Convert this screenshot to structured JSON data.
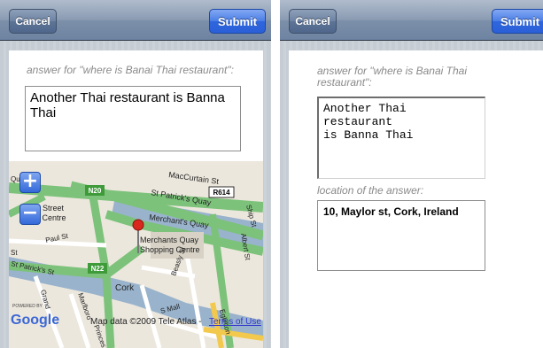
{
  "left": {
    "navbar": {
      "cancel_label": "Cancel",
      "submit_label": "Submit"
    },
    "question_label": "answer for \"where is Banai Thai restaurant\":",
    "answer_text": "Another Thai restaurant is Banna Thai",
    "map": {
      "zoom_in": "+",
      "zoom_out": "−",
      "streets": [
        "MacCurtain St",
        "St Patrick's Quay",
        "R614",
        "Ship St",
        "Merchant's Quay",
        "N20",
        "N22",
        "Paul St",
        "St Patrick's St",
        "Cork",
        "Princes St",
        "Beasly St",
        "S Mall",
        "Albert St",
        "Eglinton",
        "Grand",
        "Marlboro"
      ],
      "places": [
        "Street",
        "g Centre",
        "Merchants Quay",
        "Shopping Centre",
        "Qu",
        "St"
      ],
      "powered_by": "POWERED BY",
      "logo": "Google",
      "attribution": "Map data ©2009 Tele Atlas - ",
      "terms_link": "Terms of Use"
    }
  },
  "right": {
    "navbar": {
      "cancel_label": "Cancel",
      "submit_label": "Submit"
    },
    "question_label_line1": "answer for \"where is Banai Thai",
    "question_label_line2": "restaurant\":",
    "answer_line1": "Another Thai restaurant",
    "answer_line2": "is Banna Thai",
    "location_label": "location of the answer:",
    "location_text": "10, Maylor st, Cork, Ireland"
  }
}
